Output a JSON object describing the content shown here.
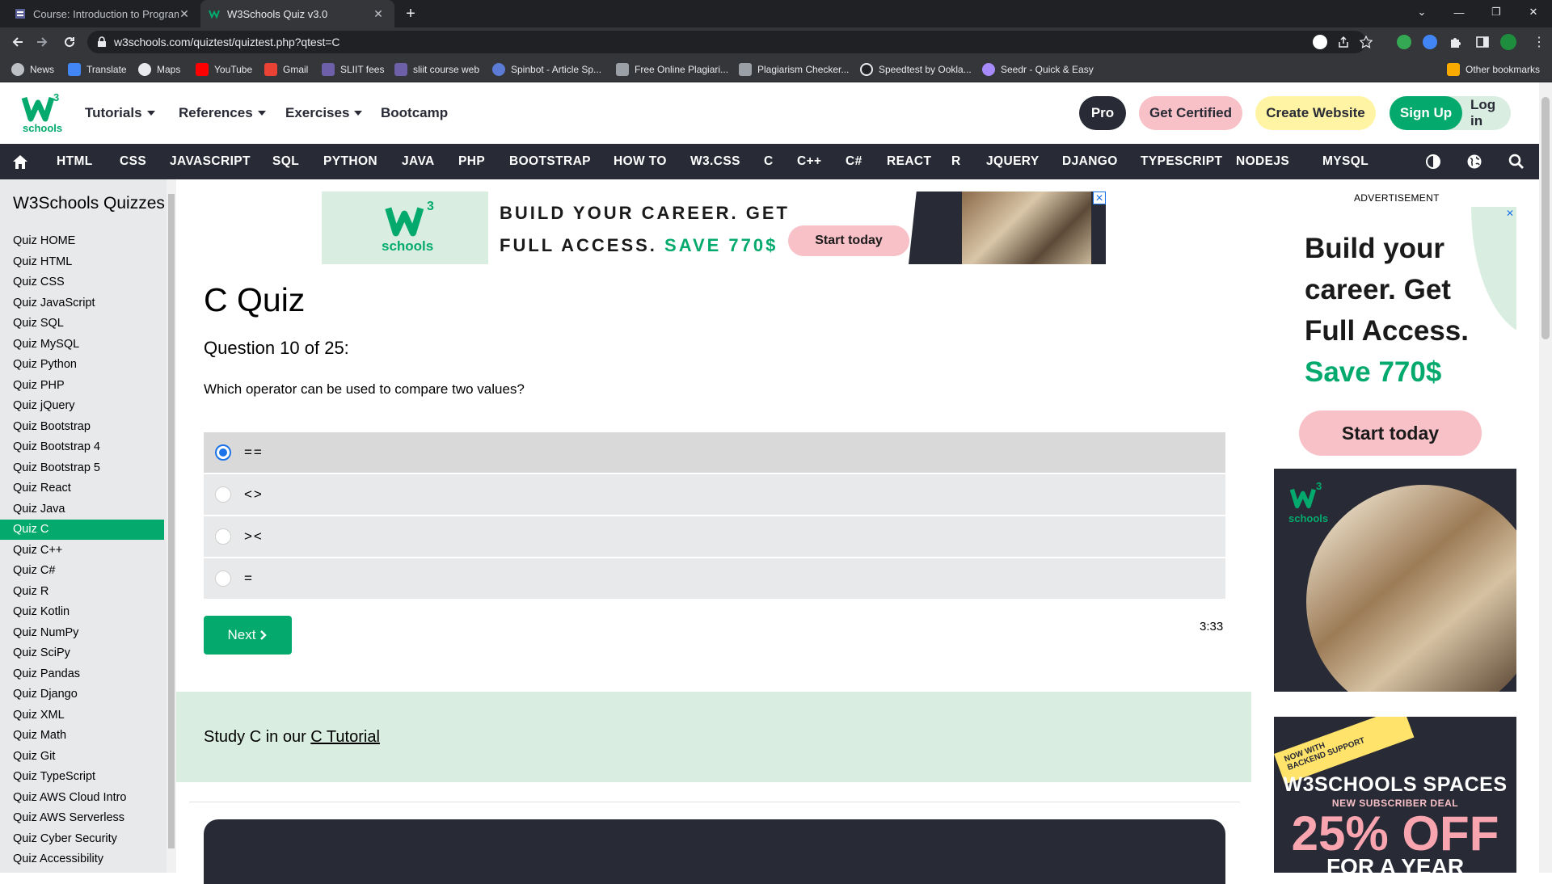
{
  "browser": {
    "tabs": [
      {
        "title": "Course: Introduction to Programm",
        "active": false
      },
      {
        "title": "W3Schools Quiz v3.0",
        "active": true
      }
    ],
    "url": "w3schools.com/quiztest/quiztest.php?qtest=C",
    "bookmarks": [
      {
        "label": "News",
        "icon": "news-icon"
      },
      {
        "label": "Translate",
        "icon": "translate-icon"
      },
      {
        "label": "Maps",
        "icon": "maps-icon"
      },
      {
        "label": "YouTube",
        "icon": "youtube-icon"
      },
      {
        "label": "Gmail",
        "icon": "gmail-icon"
      },
      {
        "label": "SLIIT fees",
        "icon": "sliit-icon"
      },
      {
        "label": "sliit course web",
        "icon": "sliit-icon"
      },
      {
        "label": "Spinbot - Article Sp...",
        "icon": "spinbot-icon"
      },
      {
        "label": "Free Online Plagiari...",
        "icon": "document-icon"
      },
      {
        "label": "Plagiarism Checker...",
        "icon": "document-icon"
      },
      {
        "label": "Speedtest by Ookla...",
        "icon": "speedtest-icon"
      },
      {
        "label": "Seedr - Quick & Easy",
        "icon": "seedr-icon"
      }
    ],
    "other_bookmarks": "Other bookmarks"
  },
  "header": {
    "logo_text": "schools",
    "logo_sup": "3",
    "menu": [
      "Tutorials",
      "References",
      "Exercises",
      "Bootcamp"
    ],
    "pro": "Pro",
    "get_certified": "Get Certified",
    "create_website": "Create Website",
    "sign_up": "Sign Up",
    "log_in": "Log in"
  },
  "topnav": [
    "HTML",
    "CSS",
    "JAVASCRIPT",
    "SQL",
    "PYTHON",
    "JAVA",
    "PHP",
    "BOOTSTRAP",
    "HOW TO",
    "W3.CSS",
    "C",
    "C++",
    "C#",
    "REACT",
    "R",
    "JQUERY",
    "DJANGO",
    "TYPESCRIPT",
    "NODEJS",
    "MYSQL"
  ],
  "sidebar": {
    "title": "W3Schools Quizzes",
    "items": [
      "Quiz HOME",
      "Quiz HTML",
      "Quiz CSS",
      "Quiz JavaScript",
      "Quiz SQL",
      "Quiz MySQL",
      "Quiz Python",
      "Quiz PHP",
      "Quiz jQuery",
      "Quiz Bootstrap",
      "Quiz Bootstrap 4",
      "Quiz Bootstrap 5",
      "Quiz React",
      "Quiz Java",
      "Quiz C",
      "Quiz C++",
      "Quiz C#",
      "Quiz R",
      "Quiz Kotlin",
      "Quiz NumPy",
      "Quiz SciPy",
      "Quiz Pandas",
      "Quiz Django",
      "Quiz XML",
      "Quiz Math",
      "Quiz Git",
      "Quiz TypeScript",
      "Quiz AWS Cloud Intro",
      "Quiz AWS Serverless",
      "Quiz Cyber Security",
      "Quiz Accessibility"
    ],
    "active_item": "Quiz C"
  },
  "banner_ad": {
    "line1": "BUILD YOUR CAREER. GET",
    "line2_prefix": "FULL ACCESS.",
    "line2_save": "SAVE 770$",
    "button": "Start today",
    "logo_text": "schools",
    "logo_sup": "3"
  },
  "quiz": {
    "title": "C Quiz",
    "question_number": "Question 10 of 25:",
    "question": "Which operator can be used to compare two values?",
    "options": [
      {
        "label": "==",
        "selected": true
      },
      {
        "label": "<>",
        "selected": false
      },
      {
        "label": "><",
        "selected": false
      },
      {
        "label": "=",
        "selected": false
      }
    ],
    "next": "Next",
    "timer": "3:33"
  },
  "study": {
    "prefix": "Study C in our",
    "link": "C Tutorial"
  },
  "right_ads": {
    "label": "ADVERTISEMENT",
    "ad1_lines": [
      "Build your",
      "career. Get",
      "Full Access."
    ],
    "ad1_save": "Save 770$",
    "ad1_button": "Start today",
    "ad2_logo_text": "schools",
    "ad2_logo_sup": "3",
    "ad3_sticker": [
      "NOW WITH",
      "BACKEND SUPPORT"
    ],
    "ad3_title": "W3SCHOOLS SPACES",
    "ad3_deal": "NEW SUBSCRIBER DEAL",
    "ad3_off": "25% OFF",
    "ad3_year": "FOR A YEAR"
  },
  "colors": {
    "brand_green": "#04aa6d",
    "nav_dark": "#282a35",
    "sidebar_bg": "#e7e9eb",
    "pink": "#f8c0c7",
    "yellow": "#fff4a3",
    "study_bg": "#d9eee1"
  }
}
